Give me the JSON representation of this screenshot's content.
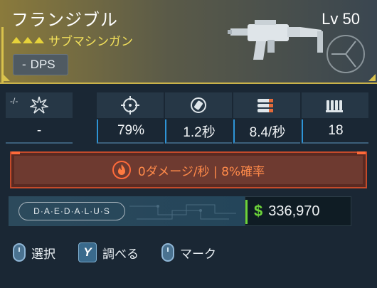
{
  "weapon": {
    "name": "フランジブル",
    "class": "サブマシンガン",
    "role": "DPS",
    "role_prefix": "-",
    "level": "Lv 50",
    "rarity_color": "#e6d23a"
  },
  "stats": [
    {
      "icon": "starburst-icon",
      "tick": "-/-",
      "value": "-"
    },
    {
      "icon": "crosshair-icon",
      "value": "79%"
    },
    {
      "icon": "reload-icon",
      "value": "1.2秒"
    },
    {
      "icon": "bullets-icon",
      "value": "8.4/秒"
    },
    {
      "icon": "magazine-icon",
      "value": "18"
    }
  ],
  "element": {
    "icon": "fire-icon",
    "text": "0ダメージ/秒 | 8%確率",
    "color": "#ff8a4a"
  },
  "manufacturer": {
    "name": "D·A·E·D·A·L·U·S"
  },
  "value": {
    "currency": "$",
    "amount": "336,970",
    "currency_color": "#6cd33a"
  },
  "prompts": [
    {
      "icon": "mouse-icon",
      "label": "選択"
    },
    {
      "icon": "y-button-icon",
      "key": "Y",
      "label": "調べる"
    },
    {
      "icon": "mouse-icon",
      "label": "マーク"
    }
  ]
}
